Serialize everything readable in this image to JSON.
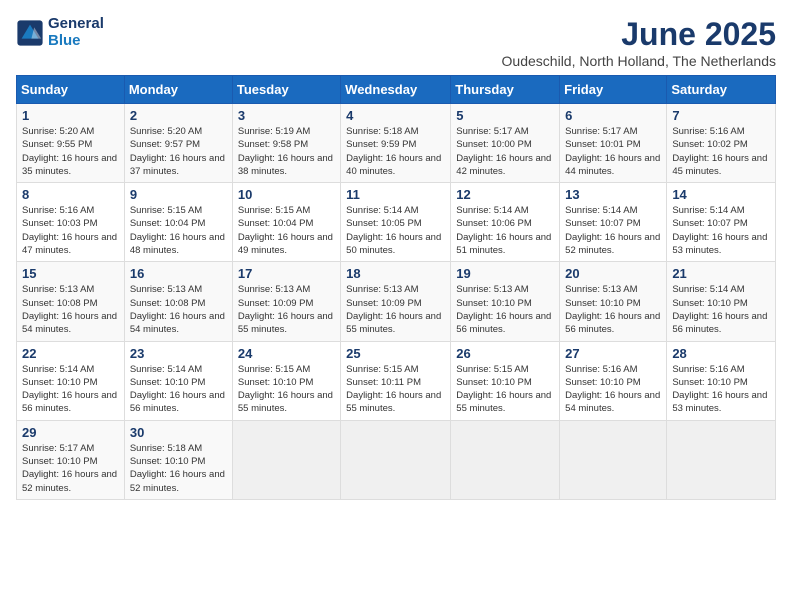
{
  "logo": {
    "line1": "General",
    "line2": "Blue"
  },
  "title": "June 2025",
  "subtitle": "Oudeschild, North Holland, The Netherlands",
  "weekdays": [
    "Sunday",
    "Monday",
    "Tuesday",
    "Wednesday",
    "Thursday",
    "Friday",
    "Saturday"
  ],
  "weeks": [
    [
      {
        "day": "1",
        "sunrise": "5:20 AM",
        "sunset": "9:55 PM",
        "daylight": "16 hours and 35 minutes."
      },
      {
        "day": "2",
        "sunrise": "5:20 AM",
        "sunset": "9:57 PM",
        "daylight": "16 hours and 37 minutes."
      },
      {
        "day": "3",
        "sunrise": "5:19 AM",
        "sunset": "9:58 PM",
        "daylight": "16 hours and 38 minutes."
      },
      {
        "day": "4",
        "sunrise": "5:18 AM",
        "sunset": "9:59 PM",
        "daylight": "16 hours and 40 minutes."
      },
      {
        "day": "5",
        "sunrise": "5:17 AM",
        "sunset": "10:00 PM",
        "daylight": "16 hours and 42 minutes."
      },
      {
        "day": "6",
        "sunrise": "5:17 AM",
        "sunset": "10:01 PM",
        "daylight": "16 hours and 44 minutes."
      },
      {
        "day": "7",
        "sunrise": "5:16 AM",
        "sunset": "10:02 PM",
        "daylight": "16 hours and 45 minutes."
      }
    ],
    [
      {
        "day": "8",
        "sunrise": "5:16 AM",
        "sunset": "10:03 PM",
        "daylight": "16 hours and 47 minutes."
      },
      {
        "day": "9",
        "sunrise": "5:15 AM",
        "sunset": "10:04 PM",
        "daylight": "16 hours and 48 minutes."
      },
      {
        "day": "10",
        "sunrise": "5:15 AM",
        "sunset": "10:04 PM",
        "daylight": "16 hours and 49 minutes."
      },
      {
        "day": "11",
        "sunrise": "5:14 AM",
        "sunset": "10:05 PM",
        "daylight": "16 hours and 50 minutes."
      },
      {
        "day": "12",
        "sunrise": "5:14 AM",
        "sunset": "10:06 PM",
        "daylight": "16 hours and 51 minutes."
      },
      {
        "day": "13",
        "sunrise": "5:14 AM",
        "sunset": "10:07 PM",
        "daylight": "16 hours and 52 minutes."
      },
      {
        "day": "14",
        "sunrise": "5:14 AM",
        "sunset": "10:07 PM",
        "daylight": "16 hours and 53 minutes."
      }
    ],
    [
      {
        "day": "15",
        "sunrise": "5:13 AM",
        "sunset": "10:08 PM",
        "daylight": "16 hours and 54 minutes."
      },
      {
        "day": "16",
        "sunrise": "5:13 AM",
        "sunset": "10:08 PM",
        "daylight": "16 hours and 54 minutes."
      },
      {
        "day": "17",
        "sunrise": "5:13 AM",
        "sunset": "10:09 PM",
        "daylight": "16 hours and 55 minutes."
      },
      {
        "day": "18",
        "sunrise": "5:13 AM",
        "sunset": "10:09 PM",
        "daylight": "16 hours and 55 minutes."
      },
      {
        "day": "19",
        "sunrise": "5:13 AM",
        "sunset": "10:10 PM",
        "daylight": "16 hours and 56 minutes."
      },
      {
        "day": "20",
        "sunrise": "5:13 AM",
        "sunset": "10:10 PM",
        "daylight": "16 hours and 56 minutes."
      },
      {
        "day": "21",
        "sunrise": "5:14 AM",
        "sunset": "10:10 PM",
        "daylight": "16 hours and 56 minutes."
      }
    ],
    [
      {
        "day": "22",
        "sunrise": "5:14 AM",
        "sunset": "10:10 PM",
        "daylight": "16 hours and 56 minutes."
      },
      {
        "day": "23",
        "sunrise": "5:14 AM",
        "sunset": "10:10 PM",
        "daylight": "16 hours and 56 minutes."
      },
      {
        "day": "24",
        "sunrise": "5:15 AM",
        "sunset": "10:10 PM",
        "daylight": "16 hours and 55 minutes."
      },
      {
        "day": "25",
        "sunrise": "5:15 AM",
        "sunset": "10:11 PM",
        "daylight": "16 hours and 55 minutes."
      },
      {
        "day": "26",
        "sunrise": "5:15 AM",
        "sunset": "10:10 PM",
        "daylight": "16 hours and 55 minutes."
      },
      {
        "day": "27",
        "sunrise": "5:16 AM",
        "sunset": "10:10 PM",
        "daylight": "16 hours and 54 minutes."
      },
      {
        "day": "28",
        "sunrise": "5:16 AM",
        "sunset": "10:10 PM",
        "daylight": "16 hours and 53 minutes."
      }
    ],
    [
      {
        "day": "29",
        "sunrise": "5:17 AM",
        "sunset": "10:10 PM",
        "daylight": "16 hours and 52 minutes."
      },
      {
        "day": "30",
        "sunrise": "5:18 AM",
        "sunset": "10:10 PM",
        "daylight": "16 hours and 52 minutes."
      },
      null,
      null,
      null,
      null,
      null
    ]
  ],
  "labels": {
    "sunrise": "Sunrise:",
    "sunset": "Sunset:",
    "daylight": "Daylight:"
  }
}
